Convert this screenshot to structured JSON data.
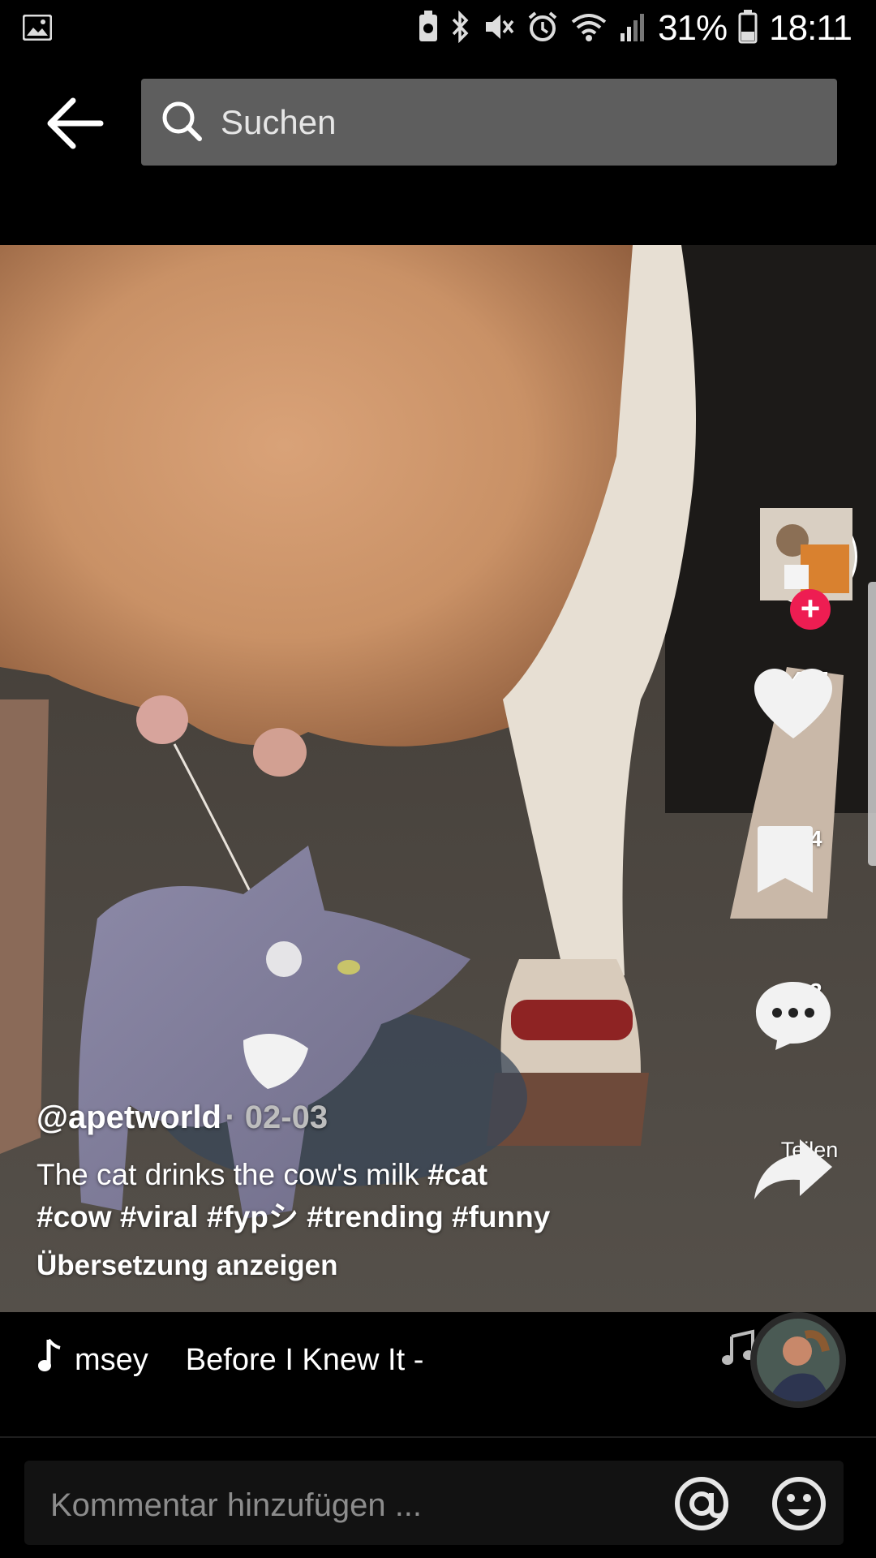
{
  "status_bar": {
    "battery": "31%",
    "time": "18:11",
    "icons": [
      "gallery-icon",
      "battery-saver-icon",
      "bluetooth-icon",
      "mute-icon",
      "alarm-icon",
      "wifi-icon",
      "signal-icon",
      "battery-icon"
    ]
  },
  "search": {
    "placeholder": "Suchen"
  },
  "post": {
    "username": "@apetworld",
    "date": "· 02-03",
    "description": "The cat drinks the cow's milk ",
    "hashtags": [
      "#cat",
      "#cow",
      "#viral",
      "#fypシ",
      "#trending",
      "#funny"
    ],
    "translate_label": "Übersetzung anzeigen"
  },
  "actions": {
    "likes": "457",
    "favorites": "14",
    "comments": "12",
    "share_label": "Teilen"
  },
  "music": {
    "marquee_part1": "msey",
    "marquee_part2": "Before I Knew It -"
  },
  "comment": {
    "placeholder": "Kommentar hinzufügen ..."
  },
  "colors": {
    "accent": "#ee1d52",
    "search_bg": "#5e5e5e"
  }
}
